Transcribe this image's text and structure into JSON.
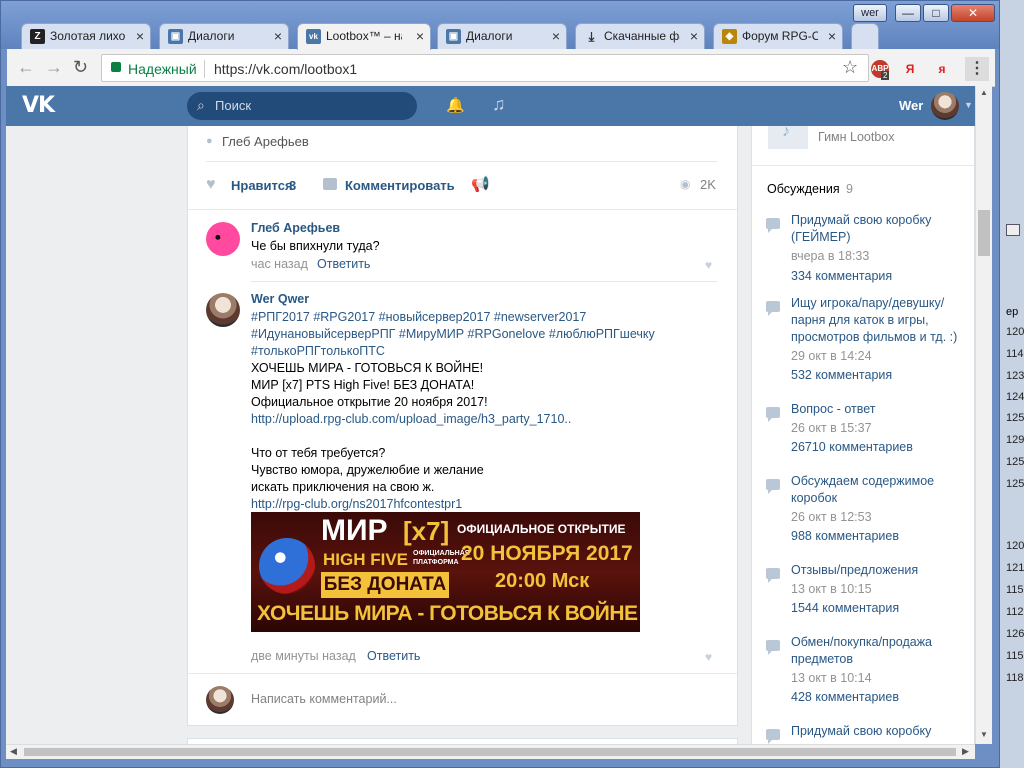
{
  "window": {
    "user_badge": "wer",
    "min_symbol": "—",
    "max_symbol": "□",
    "close_symbol": "✕"
  },
  "tabs": [
    {
      "label": "Золотая лихорадка",
      "icon": "Z"
    },
    {
      "label": "Диалоги",
      "icon": "▣"
    },
    {
      "label": "Lootbox™ – настроение",
      "icon": "vk"
    },
    {
      "label": "Диалоги",
      "icon": "▣"
    },
    {
      "label": "Скачанные файлы",
      "icon": "⤓"
    },
    {
      "label": "Форум RPG-Club",
      "icon": "◈"
    }
  ],
  "toolbar": {
    "back_symbol": "←",
    "forward_symbol": "→",
    "reload_symbol": "↻",
    "secure_label": "Надежный",
    "url": "https://vk.com/lootbox1",
    "star_symbol": "☆",
    "menu_symbol": "⋮",
    "ext_abp": "ABP",
    "ext_abp_badge": "2",
    "ext_ya1": "Я",
    "ext_ya2": "я"
  },
  "vk": {
    "logo": "VK",
    "search_placeholder": "Поиск",
    "bell_symbol": "🔔",
    "music_symbol": "♫",
    "user_name": "Wer"
  },
  "post": {
    "author_repost": "Глеб Арефьев",
    "like_label": "Нравится",
    "like_count": "3",
    "comment_label": "Комментировать",
    "views": "2K",
    "comments": [
      {
        "author": "Глеб Арефьев",
        "text": "Че бы впихнули туда?",
        "time": "час назад",
        "reply": "Ответить"
      },
      {
        "author": "Wer Qwer",
        "lines": [
          "#РПГ2017 #RPG2017 #новыйсервер2017 #newserver2017",
          "#ИдунановыйсерверРПГ #МируМИР #RPGonelove #люблюРПГшечку",
          "#толькоРПГтолькоПТС",
          "ХОЧЕШЬ МИРА - ГОТОВЬСЯ К ВОЙНЕ!",
          "МИР [x7] PTS High Five! БЕЗ ДОНАТА!",
          "Официальное открытие 20 ноября 2017!",
          "http://upload.rpg-club.com/upload_image/h3_party_1710..",
          "Что от тебя требуется?",
          "Чувство юмора, дружелюбие и желание",
          "искать приключения на свою ж.",
          "http://rpg-club.org/ns2017hfcontestpr1"
        ],
        "time": "две минуты назад",
        "reply": "Ответить"
      }
    ],
    "banner": {
      "mir": "МИР",
      "x7": "[x7]",
      "high_five": "HIGH FIVE",
      "platform1": "ОФИЦИАЛЬНАЯ",
      "platform2": "ПЛАТФОРМА",
      "no_donate": "БЕЗ ДОНАТА",
      "opening": "ОФИЦИАЛЬНОЕ ОТКРЫТИЕ",
      "date": "20 НОЯБРЯ 2017",
      "time": "20:00 Мск",
      "slogan": "ХОЧЕШЬ МИРА - ГОТОВЬСЯ К ВОЙНЕ"
    },
    "write_comment_placeholder": "Написать комментарий..."
  },
  "sidebar": {
    "audio_title": "Гимн Lootbox",
    "discussions_label": "Обсуждения",
    "discussions_count": "9",
    "discussions": [
      {
        "title": "Придумай свою коробку (ГЕЙМЕР)",
        "date": "вчера в 18:33",
        "count": "334 комментария"
      },
      {
        "title": "Ищу игрока/пару/девушку/парня для каток в игры, просмотров фильмов и тд. :)",
        "date": "29 окт в 14:24",
        "count": "532 комментария"
      },
      {
        "title": "Вопрос - ответ",
        "date": "26 окт в 15:37",
        "count": "26710 комментариев"
      },
      {
        "title": "Обсуждаем содержимое коробок",
        "date": "26 окт в 12:53",
        "count": "988 комментариев"
      },
      {
        "title": "Отзывы/предложения",
        "date": "13 окт в 10:15",
        "count": "1544 комментария"
      },
      {
        "title": "Обмен/покупка/продажа предметов",
        "date": "13 окт в 10:14",
        "count": "428 комментариев"
      },
      {
        "title": "Придумай свою коробку",
        "date": "",
        "count": ""
      }
    ]
  },
  "background_window": {
    "label": "ер",
    "numbers": [
      "120",
      "114",
      "123",
      "124",
      "125",
      "129",
      "125",
      "125",
      "120",
      "121",
      "115",
      "112",
      "126",
      "115",
      "118"
    ]
  },
  "colors": {
    "vk_blue": "#4a76a8",
    "link": "#2a5885",
    "secure_green": "#0b8043"
  }
}
